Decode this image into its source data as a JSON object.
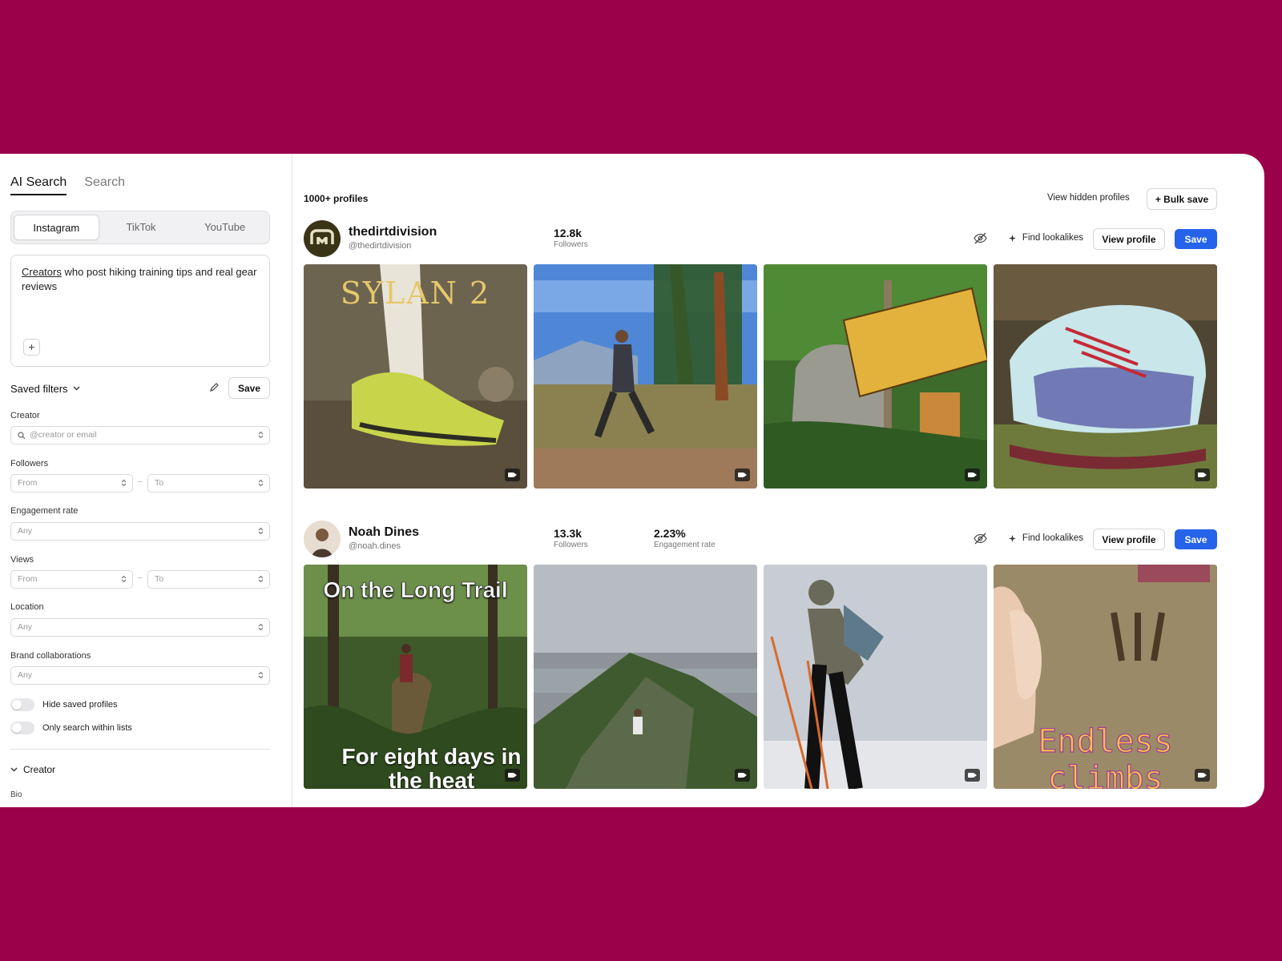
{
  "sidebar": {
    "tabs": [
      "AI Search",
      "Search"
    ],
    "platforms": [
      "Instagram",
      "TikTok",
      "YouTube"
    ],
    "prompt": {
      "word1": "Creators",
      "rest": " who post hiking training tips and real gear reviews"
    },
    "saved_filters_label": "Saved filters",
    "save_label": "Save",
    "creator_label": "Creator",
    "creator_placeholder": "@creator or email",
    "followers_label": "Followers",
    "from_placeholder": "From",
    "to_placeholder": "To",
    "engagement_label": "Engagement rate",
    "any_placeholder": "Any",
    "views_label": "Views",
    "location_label": "Location",
    "brand_label": "Brand collaborations",
    "hide_saved_label": "Hide saved profiles",
    "only_lists_label": "Only search within lists",
    "section_creator": "Creator",
    "bio_label": "Bio",
    "dash": "–"
  },
  "main": {
    "count": "1000+ profiles",
    "view_hidden": "View hidden profiles",
    "bulk_save": "+ Bulk save",
    "find_lookalikes": "Find lookalikes",
    "view_profile": "View profile",
    "save": "Save",
    "profiles": [
      {
        "name": "thedirtdivision",
        "handle": "@thedirtdivision",
        "followers": "12.8k",
        "followers_label": "Followers",
        "thumb_texts": [
          "SYLAN 2"
        ]
      },
      {
        "name": "Noah Dines",
        "handle": "@noah.dines",
        "followers": "13.3k",
        "followers_label": "Followers",
        "engagement": "2.23%",
        "engagement_label": "Engagement rate",
        "thumb_texts": [
          "On the Long Trail",
          "For eight days in",
          "the heat",
          "Endless",
          "climbs"
        ]
      }
    ]
  },
  "colors": {
    "background": "#9b004b",
    "primary": "#2563eb"
  }
}
